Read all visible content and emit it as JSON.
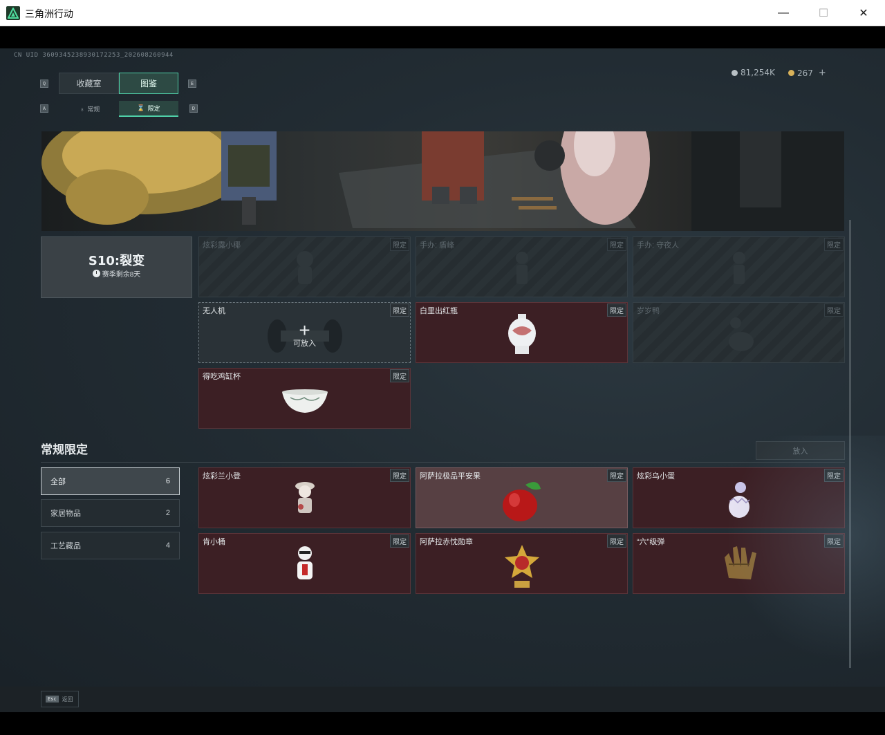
{
  "window": {
    "title": "三角洲行动",
    "minimize": "—",
    "maximize": "☐",
    "close": "✕"
  },
  "uid": "CN UID 3609345238930172253_202608260944",
  "currency": {
    "silver": "81,254K",
    "gold": "267",
    "add": "+"
  },
  "keys": {
    "q": "Q",
    "e": "E",
    "a": "A",
    "d": "D"
  },
  "tabs": [
    {
      "label": "收藏室",
      "active": false
    },
    {
      "label": "图鉴",
      "active": true
    }
  ],
  "subtabs": [
    {
      "label": "常规",
      "active": false
    },
    {
      "label": "限定",
      "active": true
    }
  ],
  "season": {
    "title": "S10:裂变",
    "remaining": "赛季剩余8天"
  },
  "season_cards": [
    {
      "name": "炫彩露小椰",
      "tag": "限定",
      "state": "locked",
      "icon": "figure-icon"
    },
    {
      "name": "手办: 盾峰",
      "tag": "限定",
      "state": "locked",
      "icon": "figure-icon"
    },
    {
      "name": "手办: 守夜人",
      "tag": "限定",
      "state": "locked",
      "icon": "figure-icon"
    },
    {
      "name": "无人机",
      "tag": "限定",
      "state": "slot",
      "slot_label": "可放入",
      "icon": "drone-icon"
    },
    {
      "name": "白里出红瓶",
      "tag": "限定",
      "state": "owned",
      "icon": "vase-icon"
    },
    {
      "name": "岁岁鸭",
      "tag": "限定",
      "state": "locked",
      "icon": "duck-icon"
    },
    {
      "name": "得吃鸡缸杯",
      "tag": "限定",
      "state": "owned",
      "icon": "bowl-icon"
    }
  ],
  "section": {
    "title": "常规限定",
    "place_button": "放入"
  },
  "filters": [
    {
      "label": "全部",
      "count": "6",
      "active": true
    },
    {
      "label": "家居物品",
      "count": "2",
      "active": false
    },
    {
      "label": "工艺藏品",
      "count": "4",
      "active": false
    }
  ],
  "regular_cards": [
    {
      "name": "炫彩兰小登",
      "tag": "限定",
      "state": "owned",
      "icon": "figurine-icon"
    },
    {
      "name": "阿萨拉极品平安果",
      "tag": "限定",
      "state": "highlight",
      "icon": "apple-icon"
    },
    {
      "name": "炫彩乌小蛋",
      "tag": "限定",
      "state": "owned",
      "icon": "egg-icon"
    },
    {
      "name": "肯小桶",
      "tag": "限定",
      "state": "owned",
      "icon": "figurine-icon"
    },
    {
      "name": "阿萨拉赤忱勋章",
      "tag": "限定",
      "state": "owned",
      "icon": "medal-icon"
    },
    {
      "name": "“六”级弹",
      "tag": "限定",
      "state": "owned",
      "icon": "hand-icon"
    }
  ],
  "footer": {
    "esc_key": "Esc",
    "esc_label": "返回"
  }
}
